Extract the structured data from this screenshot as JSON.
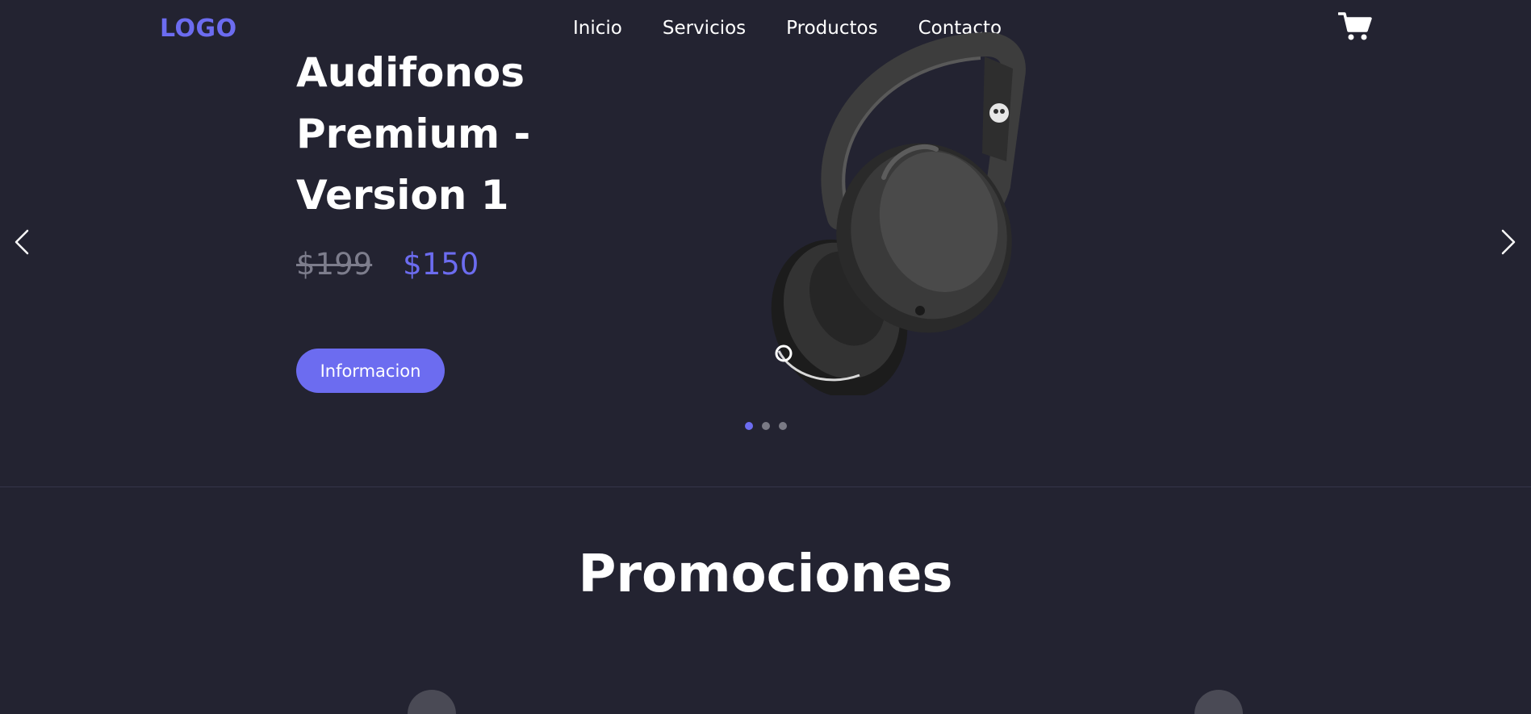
{
  "header": {
    "logo": "LOGO",
    "nav": [
      "Inicio",
      "Servicios",
      "Productos",
      "Contacto"
    ],
    "cart_icon": "shopping-cart-icon"
  },
  "hero": {
    "title": "Audifonos Premium - Version 1",
    "old_price": "$199",
    "new_price": "$150",
    "button_label": "Informacion",
    "slides_total": 3,
    "active_slide": 1
  },
  "promotions": {
    "title": "Promociones"
  },
  "colors": {
    "background": "#232331",
    "accent": "#6c6cf0",
    "text": "#ffffff",
    "muted": "#7d7d8c"
  }
}
